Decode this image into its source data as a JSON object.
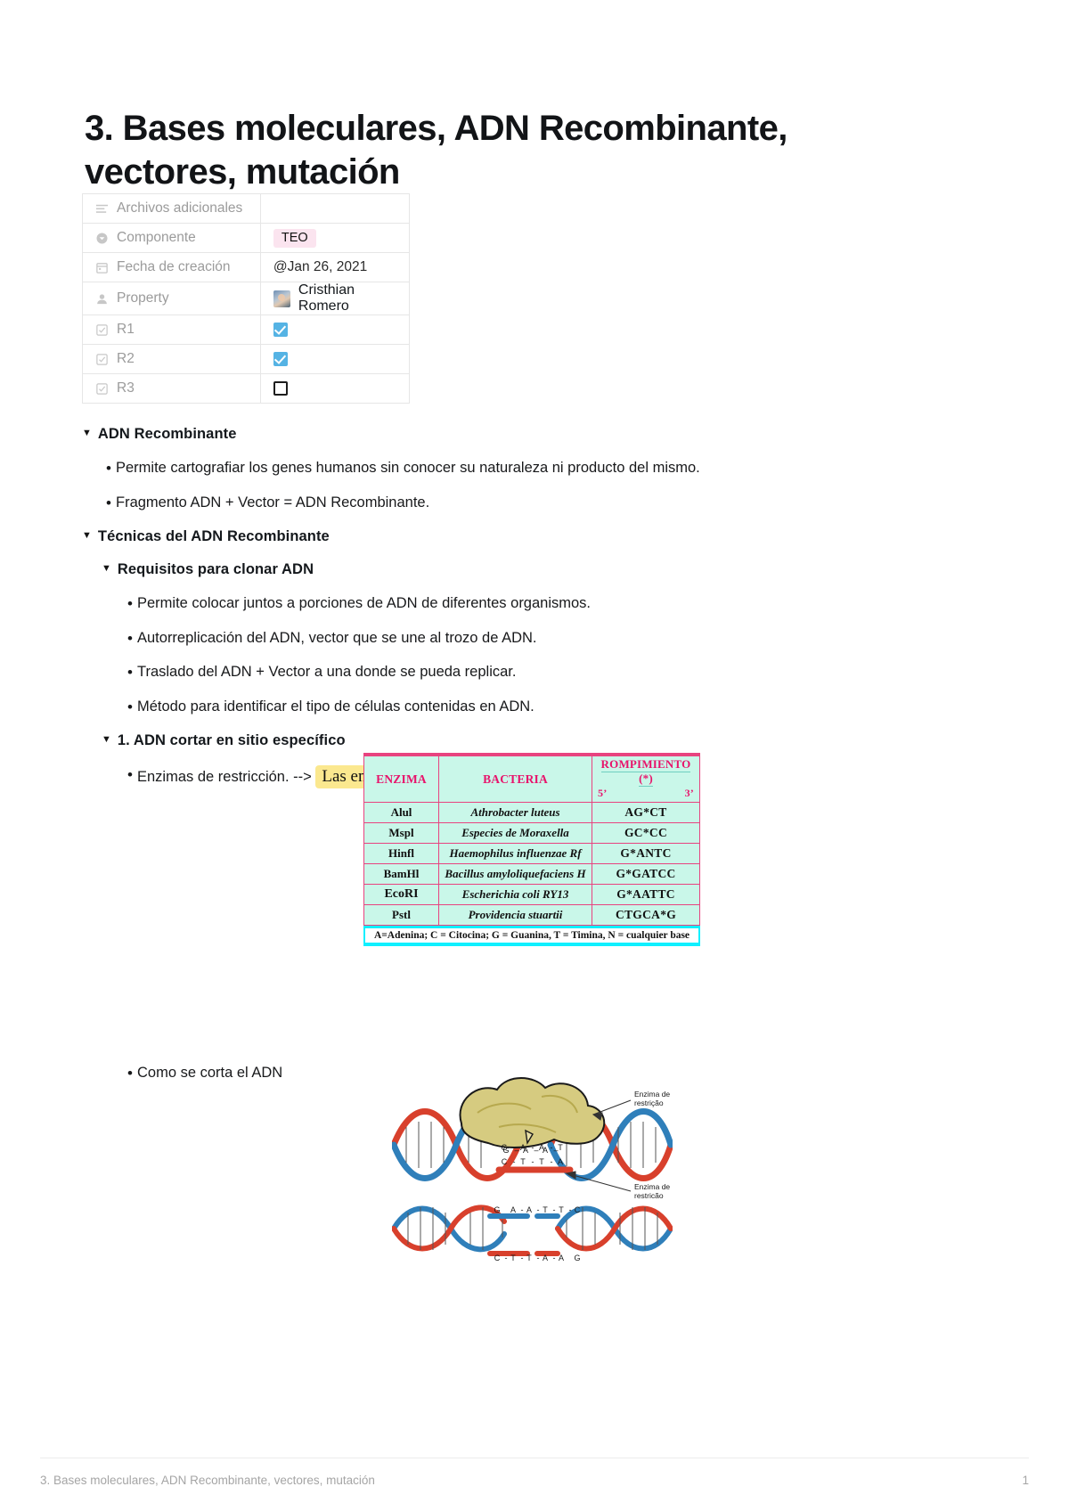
{
  "document": {
    "title": "3. Bases moleculares, ADN Recombinante, vectores, mutación"
  },
  "properties": [
    {
      "icon": "text-lines-icon",
      "label": "Archivos adicionales",
      "type": "empty",
      "value": ""
    },
    {
      "icon": "select-circle-icon",
      "label": "Componente",
      "type": "tag",
      "value": "TEO"
    },
    {
      "icon": "calendar-icon",
      "label": "Fecha de creación",
      "type": "date",
      "value": "@Jan 26, 2021"
    },
    {
      "icon": "person-icon",
      "label": "Property",
      "type": "person",
      "value": "Cristhian Romero"
    },
    {
      "icon": "checkbox-icon",
      "label": "R1",
      "type": "checkbox",
      "value": true
    },
    {
      "icon": "checkbox-icon",
      "label": "R2",
      "type": "checkbox",
      "value": true
    },
    {
      "icon": "checkbox-icon",
      "label": "R3",
      "type": "checkbox",
      "value": false
    }
  ],
  "outline": {
    "h_adn_recombinante": "ADN Recombinante",
    "b_cartografiar": "Permite cartografiar los genes humanos sin conocer su naturaleza ni producto del mismo.",
    "b_fragmento": "Fragmento ADN + Vector = ADN Recombinante.",
    "h_tecnicas": "Técnicas del ADN Recombinante",
    "h_requisitos": "Requisitos para clonar ADN",
    "b_req1": "Permite colocar juntos a porciones de ADN de diferentes organismos.",
    "b_req2": "Autorreplicación del ADN, vector que se une al trozo de ADN.",
    "b_req3": "Traslado del ADN + Vector a una donde se pueda replicar.",
    "b_req4": "Método para identificar el tipo de células contenidas en ADN.",
    "h_cortar": "1. ADN cortar en sitio específico",
    "b_enzimas_prefix": "Enzimas de restricción.  -->",
    "b_enzimas_highlight": "Las endonucleasas.",
    "b_como_se_corta": "Como se corta el ADN",
    "triangle_glyph": "▼",
    "bullet_glyph": "•"
  },
  "enzyme_table": {
    "headers": {
      "enzima": "ENZIMA",
      "bacteria": "BACTERIA",
      "rompimiento": "ROMPIMIENTO (*)",
      "five_prime": "5’",
      "three_prime": "3’"
    },
    "rows": [
      {
        "enzima": "Alul",
        "bacteria": "Athrobacter luteus",
        "rompimiento": "AG*CT"
      },
      {
        "enzima": "Mspl",
        "bacteria": "Especies de Moraxella",
        "rompimiento": "GC*CC"
      },
      {
        "enzima": "Hinfl",
        "bacteria": "Haemophilus influenzae Rf",
        "rompimiento": "G*ANTC"
      },
      {
        "enzima": "BamHl",
        "bacteria": "Bacillus amyloliquefaciens H",
        "rompimiento": "G*GATCC"
      },
      {
        "enzima": "EcoRI",
        "bacteria": "Escherichia coli RY13",
        "rompimiento": "G*AATTC"
      },
      {
        "enzima": "Pstl",
        "bacteria": "Providencia stuartii",
        "rompimiento": "CTGCA*G"
      }
    ],
    "footnote": "A=Adenina;   C = Citocina; G = Guanina, T = Timina, N = cualquier base",
    "colors": {
      "cell_bg": "#c9f7e9",
      "border": "#e8437f",
      "header_text": "#e8136b",
      "footnote_bg": "#0ff0ff"
    }
  },
  "dna_figure": {
    "label_top": "Enzima de\nrestrição",
    "label_bottom": "Enzima de\nrestrição",
    "top_strand_bases": [
      "G",
      "A",
      "A",
      "T",
      "T",
      "C"
    ],
    "bottom_strand_bases": [
      "C",
      "T",
      "T",
      "A",
      "A",
      "G"
    ],
    "cut_left_top": [
      "G"
    ],
    "cut_right_top": [
      "A",
      "A",
      "T",
      "T",
      "C"
    ],
    "cut_left_bottom": [
      "C",
      "T",
      "T",
      "A",
      "A"
    ],
    "cut_right_bottom": [
      "G"
    ],
    "colors": {
      "strand_red": "#d8402c",
      "strand_blue": "#2f7fba",
      "enzyme": "#d6cb80"
    }
  },
  "footer": {
    "text": "3. Bases moleculares, ADN Recombinante, vectores, mutación",
    "page": "1"
  }
}
